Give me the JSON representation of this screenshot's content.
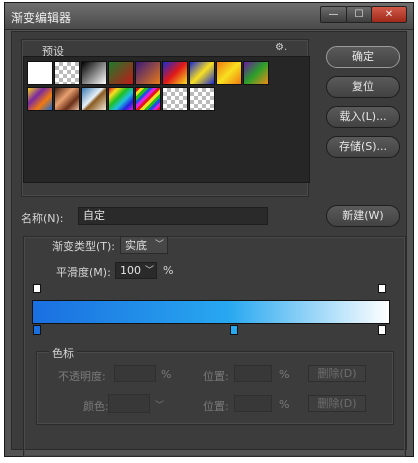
{
  "window": {
    "title": "渐变编辑器"
  },
  "titlebar_buttons": {
    "minimize": "—",
    "maximize": "☐",
    "close": "✕"
  },
  "presets": {
    "label": "预设",
    "gear_icon": "gear-icon",
    "gear_glyph": "⚙.",
    "swatches_row1": [
      "foreground-to-background",
      "checker-transparent",
      "black-to-white",
      "red-green",
      "violet-orange",
      "blue-red-yellow",
      "blue-yellow-blue",
      "orange-yellow-orange",
      "violet-green-orange"
    ],
    "swatches_row2": [
      "yellow-violet-orange-blue",
      "copper",
      "chrome",
      "spectrum",
      "rainbow-transparent",
      "transparent-rainbow",
      "transparent-stripes",
      "checker-transparent"
    ]
  },
  "buttons": {
    "ok": "确定",
    "reset": "复位",
    "load": "载入(L)...",
    "save": "存储(S)...",
    "new": "新建(W)"
  },
  "name": {
    "label": "名称(N):",
    "value": "自定"
  },
  "gradient": {
    "type_label": "渐变类型(T):",
    "type_value": "实底",
    "smoothness_label": "平滑度(M):",
    "smoothness_value": "100",
    "smoothness_unit": "%",
    "start_color": "#1a6fe0",
    "mid_color": "#28a8f0",
    "end_color": "#ffffff"
  },
  "stops": {
    "group_label": "色标",
    "opacity_label": "不透明度:",
    "opacity_unit": "%",
    "color_label": "颜色:",
    "location_label": "位置:",
    "location_unit": "%",
    "delete_label": "删除(D)",
    "location2_label": "位置:",
    "location2_unit": "%",
    "delete2_label": "删除(D)"
  }
}
